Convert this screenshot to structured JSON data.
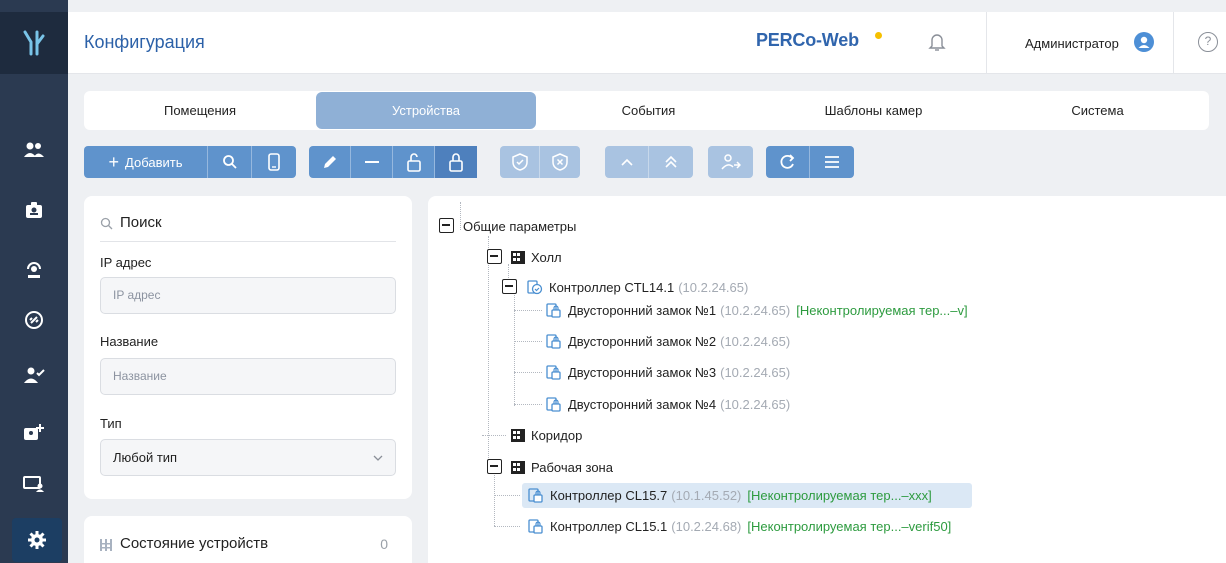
{
  "app": {
    "title": "Конфигурация",
    "brand": "PERCo-Web",
    "user": "Администратор",
    "help": "?"
  },
  "tabs": [
    "Помещения",
    "Устройства",
    "События",
    "Шаблоны камер",
    "Система"
  ],
  "toolbar": {
    "add_label": "Добавить"
  },
  "search": {
    "title": "Поиск",
    "ip_label": "IP адрес",
    "ip_placeholder": "IP адрес",
    "name_label": "Название",
    "name_placeholder": "Название",
    "type_label": "Тип",
    "type_value": "Любой тип"
  },
  "status": {
    "title": "Состояние устройств",
    "count": "0"
  },
  "tree": {
    "root": "Общие параметры",
    "hall": "Холл",
    "controller1": {
      "name": "Контроллер CTL14.1",
      "ip": "(10.2.24.65)"
    },
    "locks": [
      {
        "name": "Двусторонний замок №1",
        "ip": "(10.2.24.65)",
        "note": "[Неконтролируемая тер...–v]"
      },
      {
        "name": "Двусторонний замок №2",
        "ip": "(10.2.24.65)",
        "note": ""
      },
      {
        "name": "Двусторонний замок №3",
        "ip": "(10.2.24.65)",
        "note": ""
      },
      {
        "name": "Двусторонний замок №4",
        "ip": "(10.2.24.65)",
        "note": ""
      }
    ],
    "corridor": "Коридор",
    "workzone": "Рабочая зона",
    "controller2": {
      "name": "Контроллер CL15.7",
      "ip": "(10.1.45.52)",
      "note": "[Неконтролируемая тер...–xxx]"
    },
    "controller3": {
      "name": "Контроллер CL15.1",
      "ip": "(10.2.24.68)",
      "note": "[Неконтролируемая тер...–verif50]"
    }
  },
  "colors": {
    "nav_bg": "#2b3a51",
    "accent": "#5f93cc",
    "brand": "#3065ad",
    "note_green": "#2d9b3f"
  }
}
